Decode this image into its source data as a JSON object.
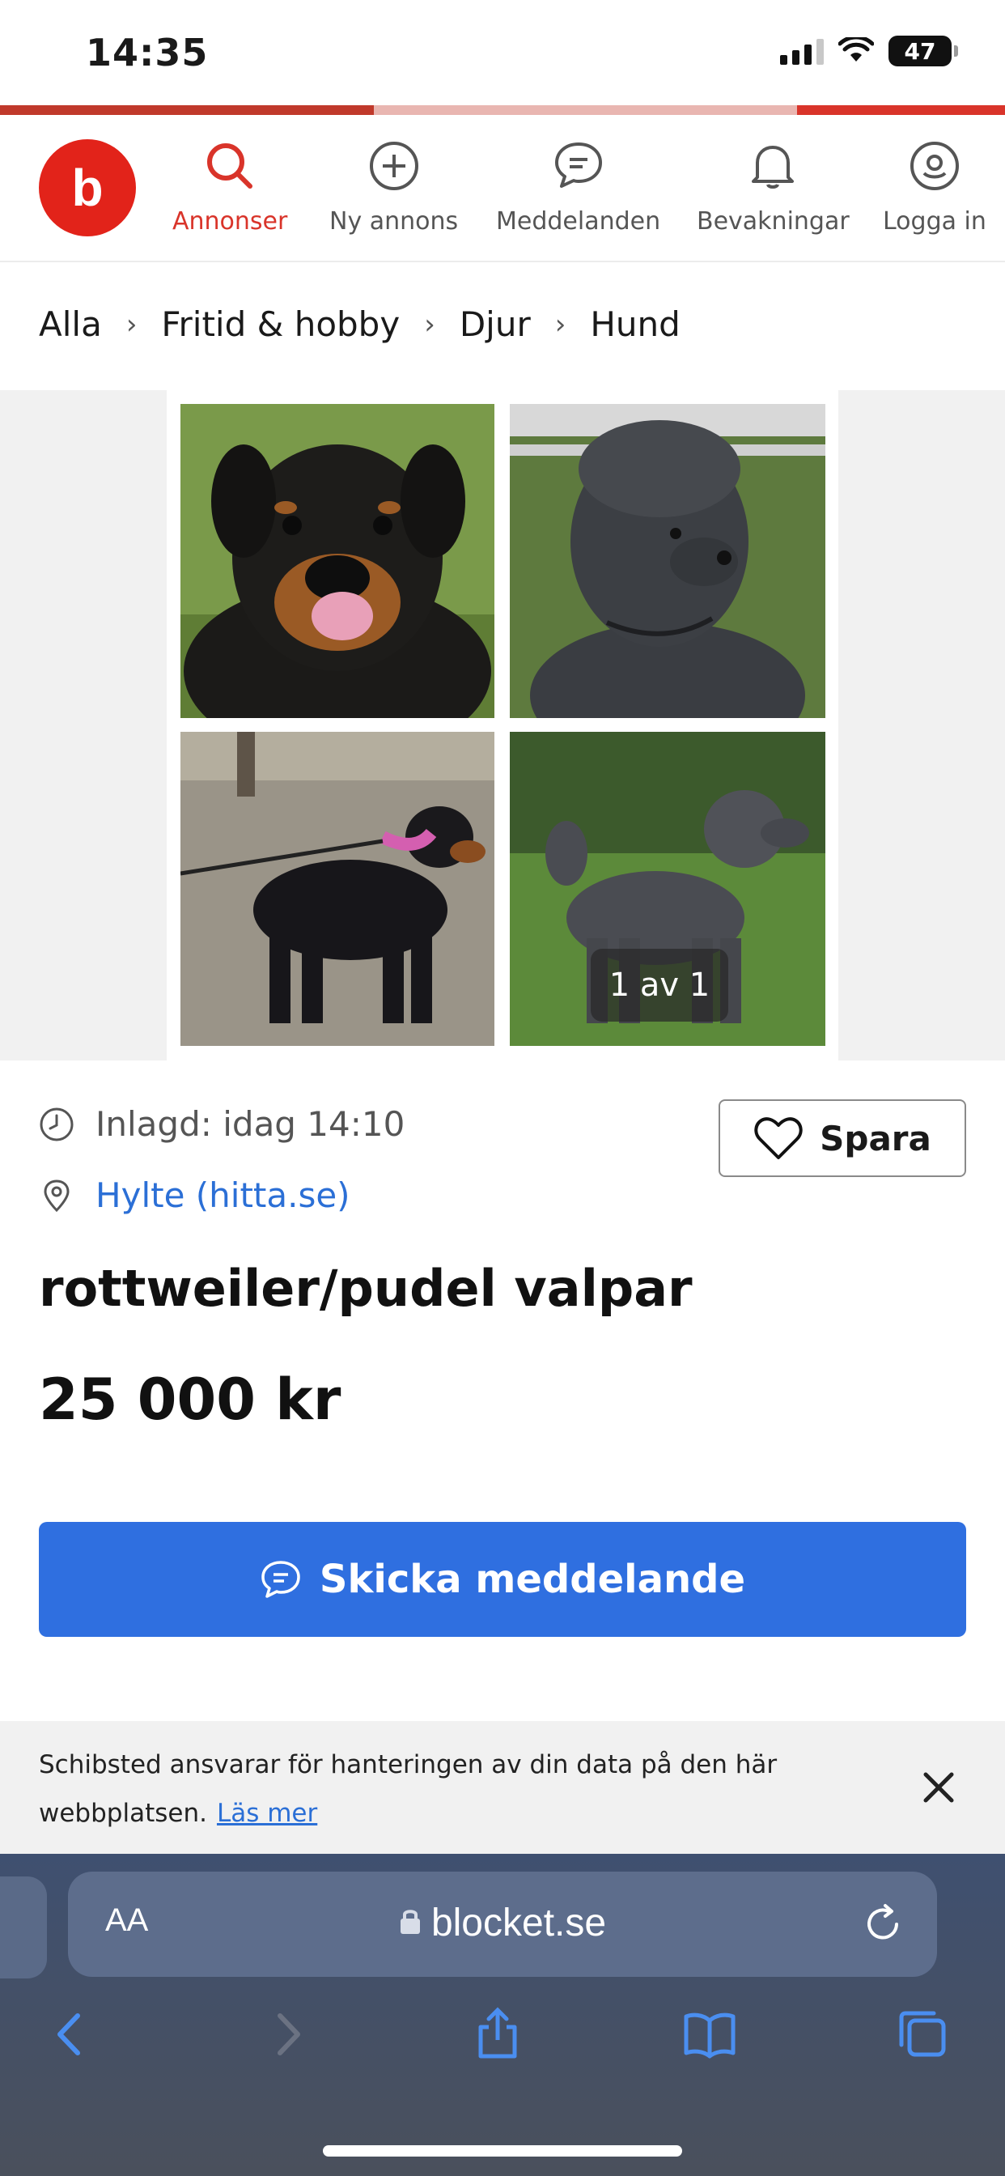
{
  "status_bar": {
    "time": "14:35",
    "battery": "47"
  },
  "nav": {
    "items": [
      {
        "label": "Annonser",
        "icon": "search-icon"
      },
      {
        "label": "Ny annons",
        "icon": "plus-circle-icon"
      },
      {
        "label": "Meddelanden",
        "icon": "chat-icon"
      },
      {
        "label": "Bevakningar",
        "icon": "bell-icon"
      },
      {
        "label": "Logga in",
        "icon": "user-icon"
      }
    ],
    "active_color": "#d9342a"
  },
  "logo": {
    "letter": "b",
    "color": "#e2231a"
  },
  "breadcrumb": [
    "Alla",
    "Fritid & hobby",
    "Djur",
    "Hund"
  ],
  "gallery": {
    "counter": "1 av 1"
  },
  "listing": {
    "posted": "Inlagd: idag 14:10",
    "location": "Hylte (hitta.se)",
    "title": "rottweiler/pudel valpar",
    "price": "25 000 kr",
    "save_label": "Spara",
    "message_label": "Skicka meddelande"
  },
  "consent": {
    "text": "Schibsted ansvarar för hanteringen av din data på den här webbplatsen.",
    "link": "Läs mer"
  },
  "browser": {
    "url": "blocket.se",
    "aa_label": "AA"
  },
  "colors": {
    "primary": "#2f6fe0",
    "brand": "#e2231a",
    "link": "#2b6fd6"
  }
}
